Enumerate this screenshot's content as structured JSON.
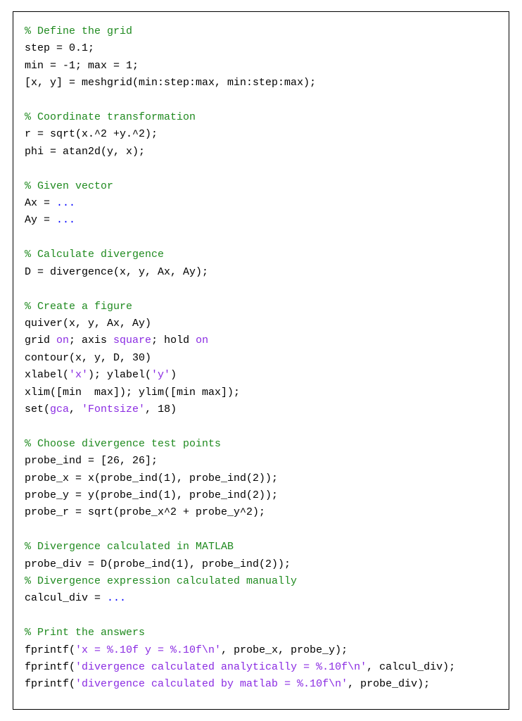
{
  "code": {
    "l01": "% Define the grid",
    "l02": "step = 0.1;",
    "l03": "min = -1; max = 1;",
    "l04": "[x, y] = meshgrid(min:step:max, min:step:max);",
    "l06": "% Coordinate transformation",
    "l07": "r = sqrt(x.^2 +y.^2);",
    "l08": "phi = atan2d(y, x);",
    "l10": "% Given vector",
    "l11a": "Ax = ",
    "l12a": "Ay = ",
    "ellipsis": "...",
    "l14": "% Calculate divergence",
    "l15": "D = divergence(x, y, Ax, Ay);",
    "l17": "% Create a figure",
    "l18": "quiver(x, y, Ax, Ay)",
    "l19a": "grid ",
    "kw_on": "on",
    "l19b": "; axis ",
    "kw_square": "square",
    "l19c": "; hold ",
    "l20": "contour(x, y, D, 30)",
    "l21a": "xlabel(",
    "str_x": "'x'",
    "l21b": "); ylabel(",
    "str_y": "'y'",
    "paren_close": ")",
    "l22": "xlim([min  max]); ylim([min max]);",
    "l23a": "set(",
    "kw_gca": "gca",
    "l23b": ", ",
    "str_font": "'Fontsize'",
    "l23c": ", 18)",
    "l25": "% Choose divergence test points",
    "l26": "probe_ind = [26, 26];",
    "l27": "probe_x = x(probe_ind(1), probe_ind(2));",
    "l28": "probe_y = y(probe_ind(1), probe_ind(2));",
    "l29": "probe_r = sqrt(probe_x^2 + probe_y^2);",
    "l31": "% Divergence calculated in MATLAB",
    "l32": "probe_div = D(probe_ind(1), probe_ind(2));",
    "l33": "% Divergence expression calculated manually",
    "l34a": "calcul_div = ",
    "l36": "% Print the answers",
    "fp": "fprintf(",
    "str_fp1": "'x = %.10f y = %.10f\\n'",
    "l37b": ", probe_x, probe_y);",
    "str_fp2": "'divergence calculated analytically = %.10f\\n'",
    "l38b": ", calcul_div);",
    "str_fp3": "'divergence calculated by matlab = %.10f\\n'",
    "l39b": ", probe_div);"
  }
}
